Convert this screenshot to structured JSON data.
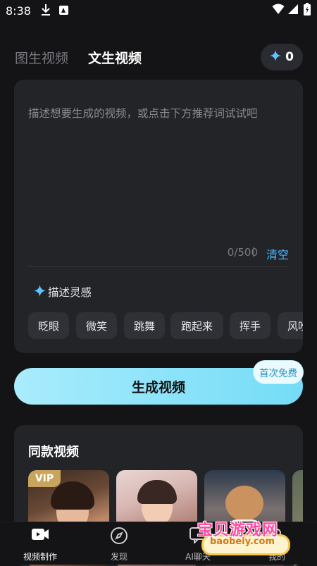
{
  "status_bar": {
    "time": "8:38"
  },
  "tabs": [
    {
      "label": "图生视频",
      "active": false
    },
    {
      "label": "文生视频",
      "active": true
    }
  ],
  "credits": {
    "icon": "sparkle-icon",
    "value": "0"
  },
  "prompt_card": {
    "placeholder": "描述想要生成的视频，或点击下方推荐词试试吧",
    "char_count": "0/500",
    "clear_label": "清空",
    "inspiration_label": "描述灵感",
    "chips": [
      "眨眼",
      "微笑",
      "跳舞",
      "跑起来",
      "挥手",
      "风吹"
    ]
  },
  "generate": {
    "label": "生成视频",
    "badge": "首次免费"
  },
  "same_style": {
    "title": "同款视频",
    "vip_label": "VIP"
  },
  "bottom_nav": [
    {
      "label": "视频制作",
      "icon": "video-camera-icon",
      "active": true
    },
    {
      "label": "发现",
      "icon": "compass-icon",
      "active": false
    },
    {
      "label": "AI聊天",
      "icon": "chat-icon",
      "active": false
    },
    {
      "label": "我的",
      "icon": "profile-icon",
      "active": false
    }
  ],
  "watermark": {
    "text_cn": "宝贝游戏网",
    "text_en": "baobeiy.com"
  },
  "colors": {
    "accent": "#47b6ff",
    "generate_gradient_start": "#a9ecfd",
    "generate_gradient_end": "#74dcf6",
    "vip_gold": "#c9a45c"
  }
}
